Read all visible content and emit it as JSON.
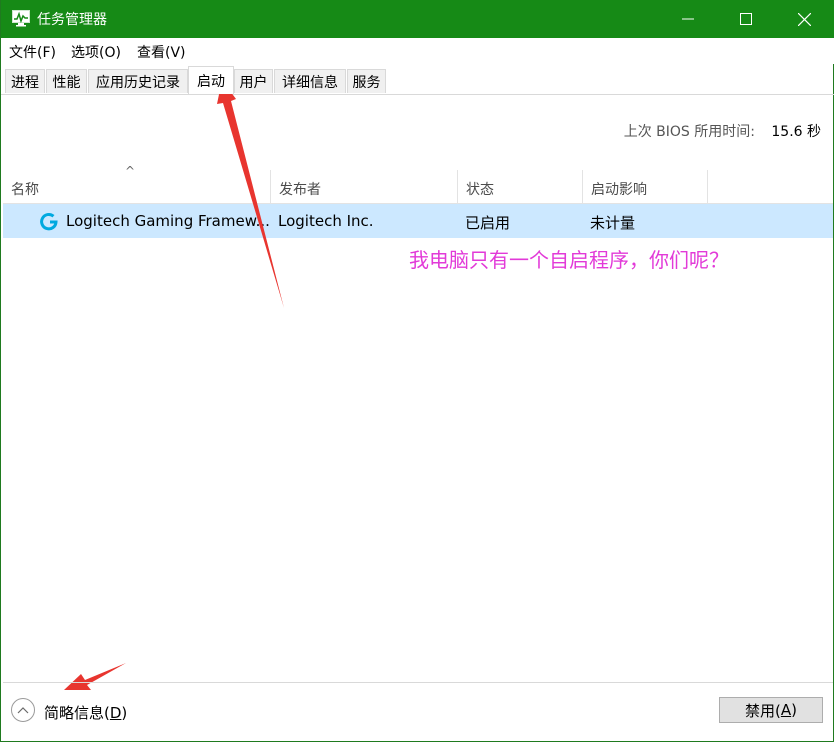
{
  "window": {
    "title": "任务管理器"
  },
  "menu": [
    "文件(F)",
    "选项(O)",
    "查看(V)"
  ],
  "tabs": [
    "进程",
    "性能",
    "应用历史记录",
    "启动",
    "用户",
    "详细信息",
    "服务"
  ],
  "active_tab": "启动",
  "bios": {
    "label": "上次 BIOS 所用时间:",
    "value": "15.6 秒"
  },
  "columns": [
    "名称",
    "发布者",
    "状态",
    "启动影响"
  ],
  "rows": [
    {
      "name": "Logitech Gaming Framew...",
      "publisher": "Logitech Inc.",
      "status": "已启用",
      "impact": "未计量"
    }
  ],
  "annotation": "我电脑只有一个自启程序，你们呢？",
  "footer": {
    "fewer_label_main": "简略信息(",
    "fewer_label_key": "D",
    "fewer_label_end": ")",
    "disable_main": "禁用(",
    "disable_key": "A",
    "disable_end": ")"
  },
  "colors": {
    "titlebar": "#168a16",
    "selected_row": "#cce8ff",
    "annotation": "#e23ad8",
    "arrow": "#e8352f"
  },
  "icons": [
    "task-manager-icon",
    "minimize-icon",
    "maximize-icon",
    "close-icon",
    "sort-up-icon",
    "logitech-g-icon",
    "chevron-up-icon"
  ]
}
